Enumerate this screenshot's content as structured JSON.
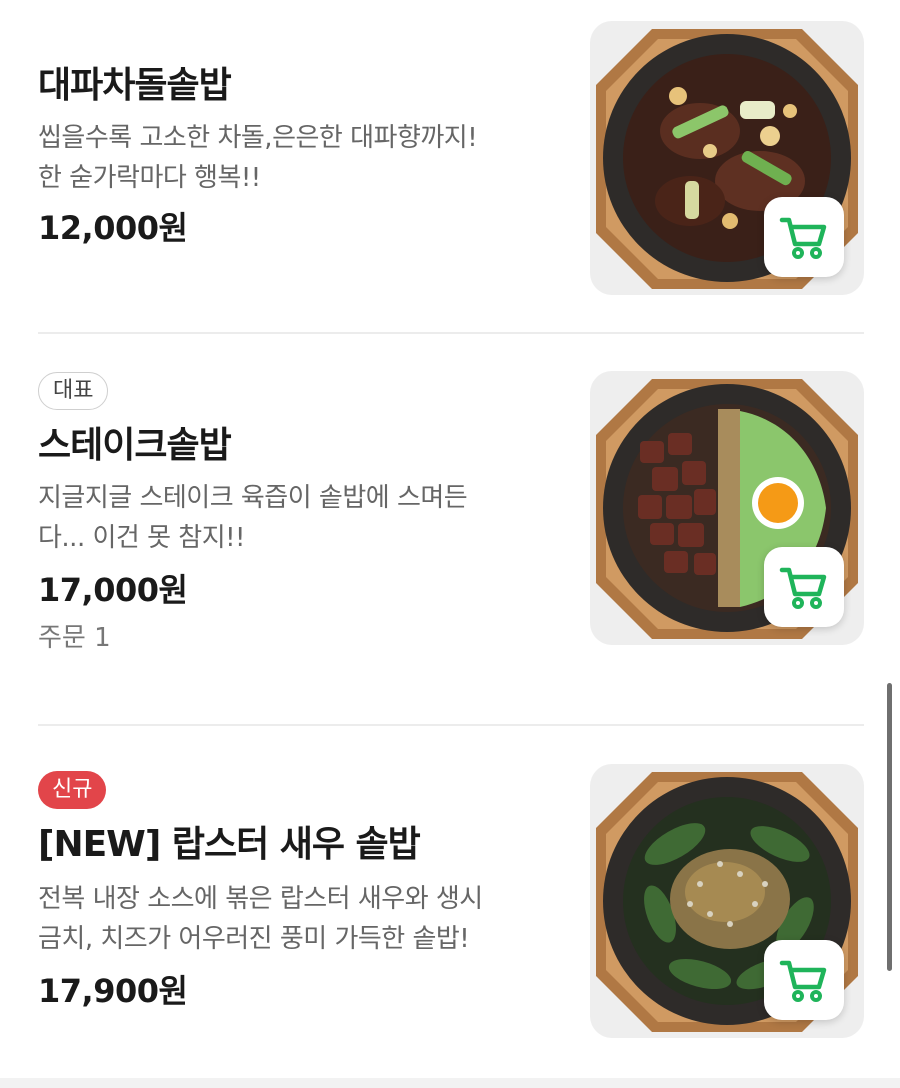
{
  "menu": {
    "items": [
      {
        "name": "대파차돌솥밥",
        "desc_line1": "씹을수록 고소한 차돌,은은한 대파향까지!",
        "desc_line2": "한 숟가락마다 행복!!",
        "price": "12,000원"
      },
      {
        "badge": "대표",
        "name": "스테이크솥밥",
        "desc_line1": "지글지글 스테이크 육즙이 솥밥에 스며든",
        "desc_line2": "다... 이건 못 참지!!",
        "price": "17,000원",
        "orders": "주문 1"
      },
      {
        "badge": "신규",
        "name": "[NEW] 랍스터 새우 솥밥",
        "desc_line1": "전복 내장 소스에 볶은 랍스터 새우와 생시",
        "desc_line2": "금치, 치즈가 어우러진 풍미 가득한 솥밥!",
        "price": "17,900원"
      }
    ]
  },
  "colors": {
    "cart_green": "#1fb45a",
    "new_badge_red": "#e2454a"
  },
  "icons": {
    "cart": "shopping-cart-icon"
  }
}
